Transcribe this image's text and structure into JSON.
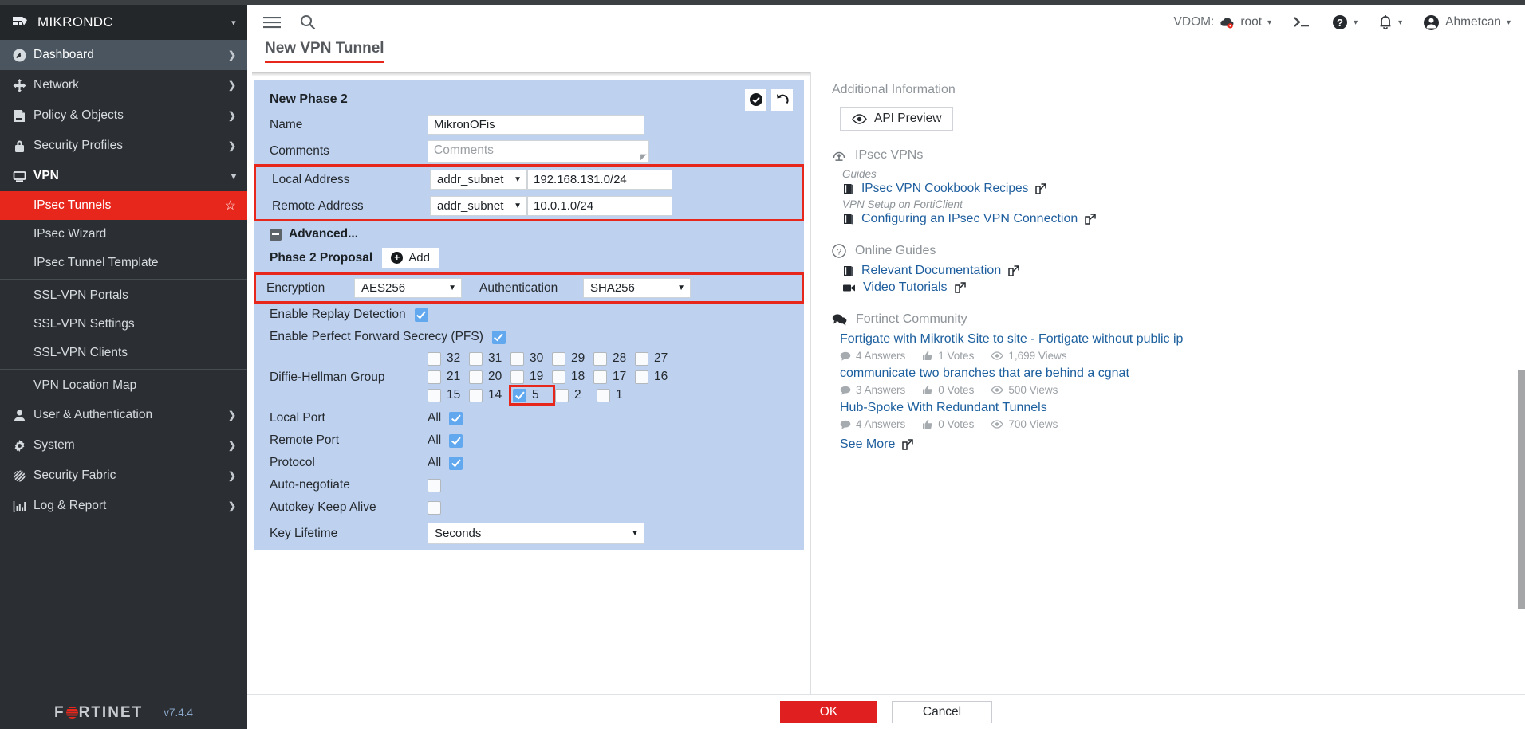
{
  "brand": {
    "name": "MIKRONDC",
    "icon": "mikron-logo-icon"
  },
  "sidebar": {
    "items": [
      {
        "label": "Dashboard",
        "icon": "dashboard-icon",
        "arrow": "❯",
        "state": "active"
      },
      {
        "label": "Network",
        "icon": "network-icon",
        "arrow": "❯",
        "state": ""
      },
      {
        "label": "Policy & Objects",
        "icon": "policy-icon",
        "arrow": "❯",
        "state": ""
      },
      {
        "label": "Security Profiles",
        "icon": "shield-lock-icon",
        "arrow": "❯",
        "state": ""
      },
      {
        "label": "VPN",
        "icon": "vpn-monitor-icon",
        "arrow": "⌄",
        "state": "open"
      }
    ],
    "vpn_subitems": [
      {
        "label": "IPsec Tunnels",
        "selected": true,
        "star": "☆"
      },
      {
        "label": "IPsec Wizard",
        "selected": false
      },
      {
        "label": "IPsec Tunnel Template",
        "selected": false
      },
      {
        "divider": true
      },
      {
        "label": "SSL-VPN Portals",
        "selected": false
      },
      {
        "label": "SSL-VPN Settings",
        "selected": false
      },
      {
        "label": "SSL-VPN Clients",
        "selected": false
      },
      {
        "divider": true
      },
      {
        "label": "VPN Location Map",
        "selected": false
      }
    ],
    "items_after": [
      {
        "label": "User & Authentication",
        "icon": "user-icon",
        "arrow": "❯"
      },
      {
        "label": "System",
        "icon": "gear-icon",
        "arrow": "❯"
      },
      {
        "label": "Security Fabric",
        "icon": "fabric-icon",
        "arrow": "❯"
      },
      {
        "label": "Log & Report",
        "icon": "chart-bar-icon",
        "arrow": "❯"
      }
    ],
    "footer": {
      "logo_text_1": "F",
      "logo_text_2": "RTINET",
      "version": "v7.4.4"
    }
  },
  "header": {
    "hamburger_icon": "hamburger-menu-icon",
    "search_icon": "search-icon",
    "vdom_label": "VDOM:",
    "vdom_value": "root",
    "cli_icon": "cli-console-icon",
    "help_icon": "help-question-icon",
    "notification_icon": "bell-icon",
    "user_name": "Ahmetcan",
    "caret": "▾"
  },
  "page": {
    "title": "New VPN Tunnel"
  },
  "form": {
    "panel_title": "New Phase 2",
    "apply_icon": "check-circle-icon",
    "revert_icon": "revert-undo-icon",
    "name_label": "Name",
    "name_value": "MikronOFis",
    "comments_label": "Comments",
    "comments_placeholder": "Comments",
    "local_address_label": "Local Address",
    "local_address_type": "addr_subnet",
    "local_address_value": "192.168.131.0/24",
    "remote_address_label": "Remote Address",
    "remote_address_type": "addr_subnet",
    "remote_address_value": "10.0.1.0/24",
    "advanced_label": "Advanced...",
    "proposal_label": "Phase 2 Proposal",
    "add_label": "Add",
    "encryption_label": "Encryption",
    "encryption_value": "AES256",
    "authentication_label": "Authentication",
    "authentication_value": "SHA256",
    "replay_label": "Enable Replay Detection",
    "replay_checked": true,
    "pfs_label": "Enable Perfect Forward Secrecy (PFS)",
    "pfs_checked": true,
    "dh_label": "Diffie-Hellman Group",
    "dh_groups": [
      [
        {
          "n": "32",
          "c": false
        },
        {
          "n": "31",
          "c": false
        },
        {
          "n": "30",
          "c": false
        },
        {
          "n": "29",
          "c": false
        },
        {
          "n": "28",
          "c": false
        },
        {
          "n": "27",
          "c": false
        }
      ],
      [
        {
          "n": "21",
          "c": false
        },
        {
          "n": "20",
          "c": false
        },
        {
          "n": "19",
          "c": false
        },
        {
          "n": "18",
          "c": false
        },
        {
          "n": "17",
          "c": false
        },
        {
          "n": "16",
          "c": false
        }
      ],
      [
        {
          "n": "15",
          "c": false
        },
        {
          "n": "14",
          "c": false
        },
        {
          "n": "5",
          "c": true,
          "hl": true
        },
        {
          "n": "2",
          "c": false
        },
        {
          "n": "1",
          "c": false
        }
      ]
    ],
    "local_port_label": "Local Port",
    "local_port_all": "All",
    "local_port_checked": true,
    "remote_port_label": "Remote Port",
    "remote_port_all": "All",
    "remote_port_checked": true,
    "protocol_label": "Protocol",
    "protocol_all": "All",
    "protocol_checked": true,
    "autonegotiate_label": "Auto-negotiate",
    "autonegotiate_checked": false,
    "autokey_label": "Autokey Keep Alive",
    "autokey_checked": false,
    "keylifetime_label": "Key Lifetime",
    "keylifetime_value": "Seconds",
    "highlight_color": "#e8271c"
  },
  "footer_buttons": {
    "ok": "OK",
    "cancel": "Cancel"
  },
  "right_panel": {
    "title": "Additional Information",
    "api_preview": "API Preview",
    "api_icon": "eye-icon",
    "sections": [
      {
        "icon": "ipsec-vpn-icon",
        "title": "IPsec VPNs",
        "groups": [
          {
            "subhead": "Guides",
            "links": [
              {
                "label": "IPsec VPN Cookbook Recipes",
                "icon": "book-icon",
                "ext": "external-link-icon"
              }
            ]
          },
          {
            "subhead": "VPN Setup on FortiClient",
            "links": [
              {
                "label": "Configuring an IPsec VPN Connection",
                "icon": "book-icon",
                "ext": "external-link-icon"
              }
            ]
          }
        ]
      },
      {
        "icon": "help-question-icon",
        "title": "Online Guides",
        "groups": [
          {
            "subhead": "",
            "links": [
              {
                "label": "Relevant Documentation",
                "icon": "book-icon",
                "ext": "external-link-icon"
              },
              {
                "label": "Video Tutorials",
                "icon": "video-camera-icon",
                "ext": "external-link-icon"
              }
            ]
          }
        ]
      }
    ],
    "community": {
      "icon": "comments-icon",
      "title": "Fortinet Community",
      "items": [
        {
          "title": "Fortigate with Mikrotik Site to site - Fortigate without public ip",
          "answers": "4 Answers",
          "votes": "1 Votes",
          "views": "1,699 Views"
        },
        {
          "title": "communicate two branches that are behind a cgnat",
          "answers": "3 Answers",
          "votes": "0 Votes",
          "views": "500 Views"
        },
        {
          "title": "Hub-Spoke With Redundant Tunnels",
          "answers": "4 Answers",
          "votes": "0 Votes",
          "views": "700 Views"
        }
      ],
      "see_more": "See More",
      "see_more_ext": "external-link-icon",
      "answers_icon": "comment-icon",
      "votes_icon": "thumbs-up-icon",
      "views_icon": "eye-icon"
    }
  }
}
